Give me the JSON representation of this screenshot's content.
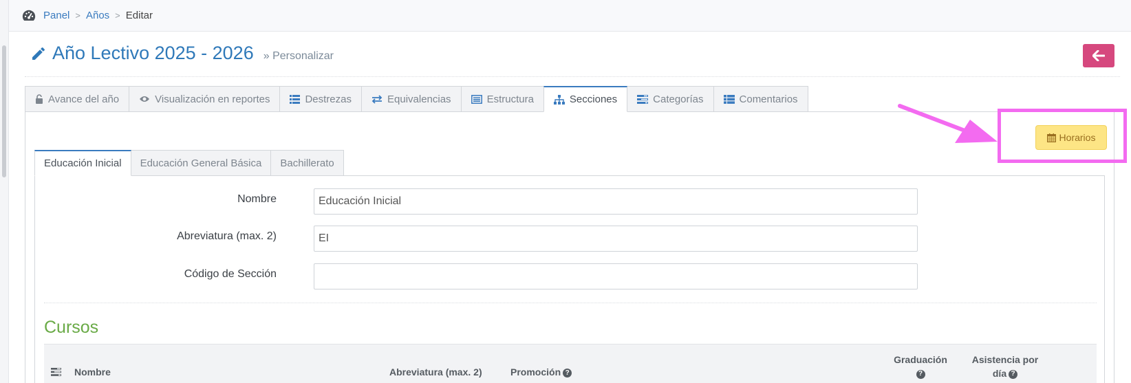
{
  "breadcrumb": {
    "items": [
      {
        "label": "Panel"
      },
      {
        "label": "Años"
      }
    ],
    "current": "Editar"
  },
  "header": {
    "title": "Año Lectivo 2025 - 2026",
    "subtitle": "» Personalizar"
  },
  "tabs": [
    {
      "label": "Avance del año",
      "icon": "unlock-icon"
    },
    {
      "label": "Visualización en reportes",
      "icon": "eye-icon"
    },
    {
      "label": "Destrezas",
      "icon": "list-icon"
    },
    {
      "label": "Equivalencias",
      "icon": "exchange-icon"
    },
    {
      "label": "Estructura",
      "icon": "list-alt-icon"
    },
    {
      "label": "Secciones",
      "icon": "sitemap-icon",
      "active": true
    },
    {
      "label": "Categorías",
      "icon": "tasks-icon"
    },
    {
      "label": "Comentarios",
      "icon": "list-table-icon"
    }
  ],
  "actions": {
    "horarios_label": "Horarios"
  },
  "subtabs": [
    {
      "label": "Educación Inicial",
      "active": true
    },
    {
      "label": "Educación General Básica"
    },
    {
      "label": "Bachillerato"
    }
  ],
  "form": {
    "nombre_label": "Nombre",
    "nombre_value": "Educación Inicial",
    "abreviatura_label": "Abreviatura (max. 2)",
    "abreviatura_value": "EI",
    "codigo_label": "Código de Sección",
    "codigo_value": ""
  },
  "cursos": {
    "title": "Cursos",
    "columns": {
      "nombre": "Nombre",
      "abreviatura": "Abreviatura (max. 2)",
      "promocion": "Promoción",
      "graduacion": "Graduación",
      "asistencia_line1": "Asistencia por",
      "asistencia_line2": "día"
    }
  },
  "colors": {
    "link": "#3a7bbf",
    "title": "#2f79b9",
    "back_button": "#d6487e",
    "horarios_button": "#fde585",
    "cursos_title": "#69aa46",
    "annotation": "#f36bf0"
  }
}
